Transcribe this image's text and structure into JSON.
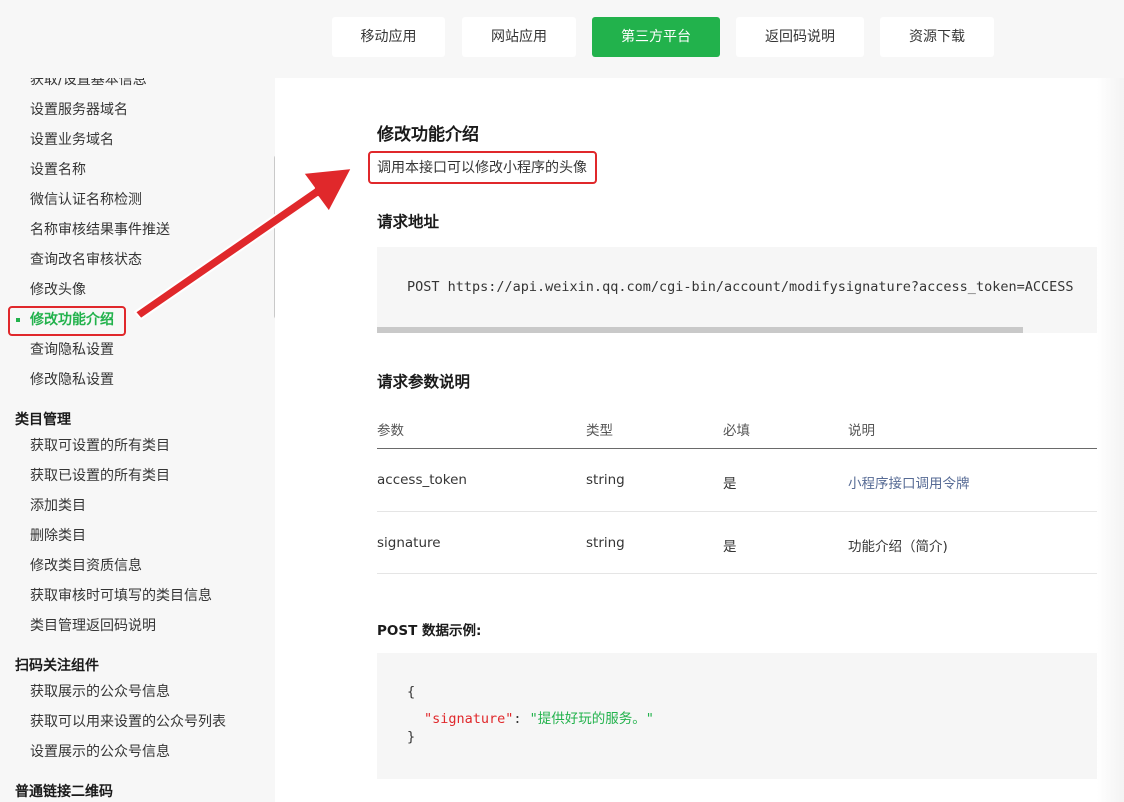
{
  "topnav": {
    "tabs": [
      {
        "label": "移动应用",
        "active": false
      },
      {
        "label": "网站应用",
        "active": false
      },
      {
        "label": "第三方平台",
        "active": true
      },
      {
        "label": "返回码说明",
        "active": false
      },
      {
        "label": "资源下载",
        "active": false
      }
    ]
  },
  "sidebar": {
    "items_top": [
      "获取/设置基本信息",
      "设置服务器域名",
      "设置业务域名",
      "设置名称",
      "微信认证名称检测",
      "名称审核结果事件推送",
      "查询改名审核状态",
      "修改头像",
      "修改功能介绍",
      "查询隐私设置",
      "修改隐私设置"
    ],
    "group_category": "类目管理",
    "items_category": [
      "获取可设置的所有类目",
      "获取已设置的所有类目",
      "添加类目",
      "删除类目",
      "修改类目资质信息",
      "获取审核时可填写的类目信息",
      "类目管理返回码说明"
    ],
    "group_scan": "扫码关注组件",
    "items_scan": [
      "获取展示的公众号信息",
      "获取可以用来设置的公众号列表",
      "设置展示的公众号信息"
    ],
    "group_qrcode": "普通链接二维码"
  },
  "main": {
    "title": "修改功能介绍",
    "description": "调用本接口可以修改小程序的头像",
    "request_url_heading": "请求地址",
    "request_url": "POST https://api.weixin.qq.com/cgi-bin/account/modifysignature?access_token=ACCESS",
    "params_heading": "请求参数说明",
    "params_table": {
      "headers": [
        "参数",
        "类型",
        "必填",
        "说明"
      ],
      "rows": [
        [
          "access_token",
          "string",
          "是",
          "小程序接口调用令牌"
        ],
        [
          "signature",
          "string",
          "是",
          "功能介绍（简介)"
        ]
      ]
    },
    "example_heading": "POST 数据示例:",
    "example_code": {
      "open": "{",
      "key": "\"signature\"",
      "colon": ": ",
      "value": "\"提供好玩的服务。\"",
      "close": "}"
    }
  },
  "colors": {
    "accent_green": "#22b24c",
    "highlight_red": "#e0282b",
    "link_blue": "#576b95"
  }
}
